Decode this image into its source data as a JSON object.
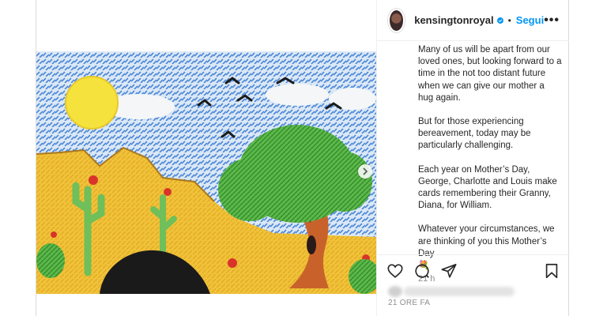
{
  "post": {
    "username": "kensingtonroyal",
    "follow_label": "Segui",
    "separator": "•",
    "more_label": "•••",
    "caption_paragraphs": [
      "Many of us will be apart from our loved ones, but looking forward to a time in the not too distant future when we can give our mother a hug again.",
      "But for those experiencing bereavement, today may be particularly challenging.",
      "Each year on Mother’s Day, George, Charlotte and Louis make cards remembering their Granny, Diana, for William.",
      "Whatever your circumstances, we are thinking of you this Mother’s Day"
    ],
    "caption_emoji": "💐",
    "relative_time": "21 h",
    "posted_label": "21 ORE FA"
  },
  "icons": {
    "verified": "verified-badge-icon",
    "like": "heart-icon",
    "comment": "comment-icon",
    "share": "paper-plane-icon",
    "save": "bookmark-icon",
    "next": "chevron-right-icon"
  },
  "colors": {
    "accent": "#0095f6",
    "text": "#262626",
    "muted": "#8e8e8e",
    "border": "#dbdbdb"
  }
}
